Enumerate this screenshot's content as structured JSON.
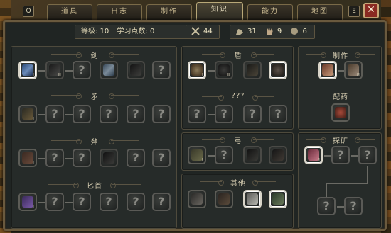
{
  "tabs": [
    {
      "label": "道具"
    },
    {
      "label": "日志"
    },
    {
      "label": "制作"
    },
    {
      "label": "知识",
      "active": true
    },
    {
      "label": "能力"
    },
    {
      "label": "地图"
    }
  ],
  "hotkeys": {
    "left": "Q",
    "right": "E"
  },
  "close_label": "✕",
  "stats": {
    "level_label": "等级:",
    "level_value": "10",
    "points_label": "学习点数:",
    "points_value": "0",
    "combat_value": "44",
    "strength_value": "31",
    "agility_value": "9",
    "wits_value": "6"
  },
  "sections": {
    "sword": "剑",
    "spear": "矛",
    "axe": "斧",
    "dagger": "匕首",
    "shield": "盾",
    "unknown": "???",
    "bow": "弓",
    "other": "其他",
    "crafting": "制作",
    "alchemy": "配药",
    "mining": "探矿"
  },
  "slot_glyphs": {
    "unknown": "?",
    "level_one": "I",
    "level_two": "II"
  },
  "colors": {
    "accent": "#b8a878",
    "window_bg": "#202523",
    "close_red": "#8a2a22"
  }
}
